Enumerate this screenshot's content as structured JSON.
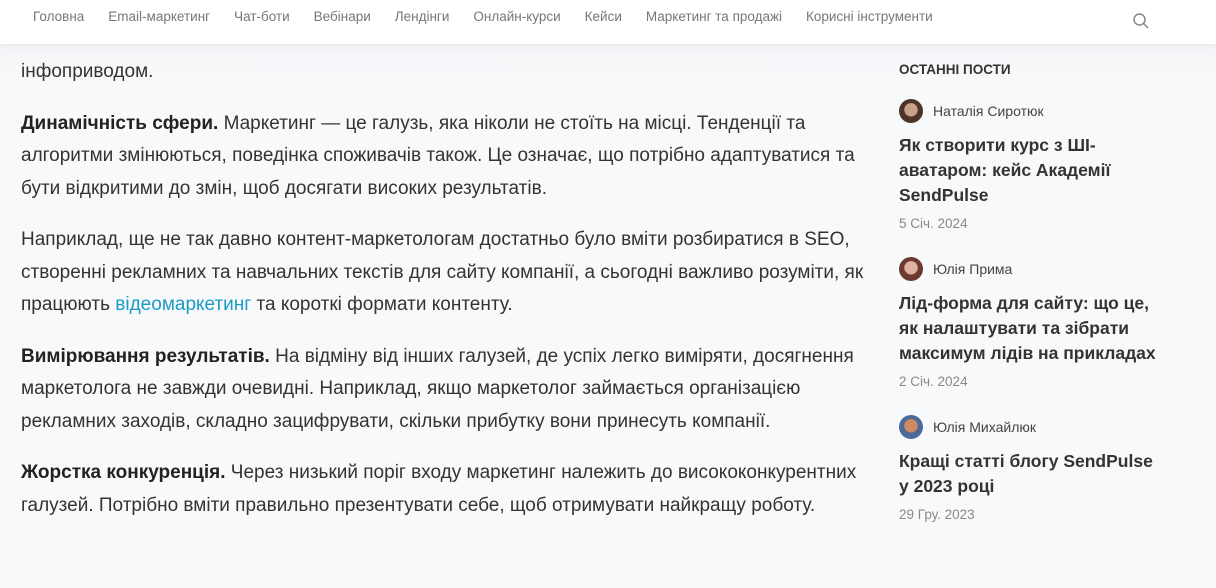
{
  "nav": {
    "items": [
      "Головна",
      "Email-маркетинг",
      "Чат-боти",
      "Вебінари",
      "Лендінги",
      "Онлайн-курси",
      "Кейси",
      "Маркетинг та продажі",
      "Корисні інструменти"
    ]
  },
  "article": {
    "p0": "інфоприводом.",
    "p1_bold": "Динамічність сфери.",
    "p1": " Маркетинг — це галузь, яка ніколи не стоїть на місці. Тенденції та алгоритми змінюються, поведінка споживачів також. Це означає, що потрібно адаптуватися та бути відкритими до змін, щоб досягати високих результатів.",
    "p2a": "Наприклад, ще не так давно контент-маркетологам достатньо було вміти розбиратися в SEO, створенні рекламних та навчальних текстів для сайту компанії, а сьогодні важливо розуміти, як працюють ",
    "p2_link": "відеомаркетинг",
    "p2b": " та короткі формати контенту.",
    "p3_bold": "Вимірювання результатів.",
    "p3": " На відміну від інших галузей, де успіх легко виміряти, досягнення маркетолога не завжди очевидні. Наприклад, якщо маркетолог займається організацією рекламних заходів, складно зацифрувати, скільки прибутку вони принесуть компанії.",
    "p4_bold": "Жорстка конкуренція.",
    "p4": " Через низький поріг входу маркетинг належить до висококонкурентних галузей. Потрібно вміти правильно презентувати себе, щоб отримувати найкращу роботу."
  },
  "sidebar": {
    "heading": "ОСТАННІ ПОСТИ",
    "posts": [
      {
        "author": "Наталія Сиротюк",
        "title": "Як створити курс з ШІ-аватаром: кейс Академії SendPulse",
        "date": "5 Січ. 2024"
      },
      {
        "author": "Юлія Прима",
        "title": "Лід-форма для сайту: що це, як налаштувати та зібрати максимум лідів на прикладах",
        "date": "2 Січ. 2024"
      },
      {
        "author": "Юлія Михайлюк",
        "title": "Кращі статті блогу SendPulse у 2023 році",
        "date": "29 Гру. 2023"
      }
    ]
  },
  "colors": {
    "link": "#1a9bc6"
  }
}
